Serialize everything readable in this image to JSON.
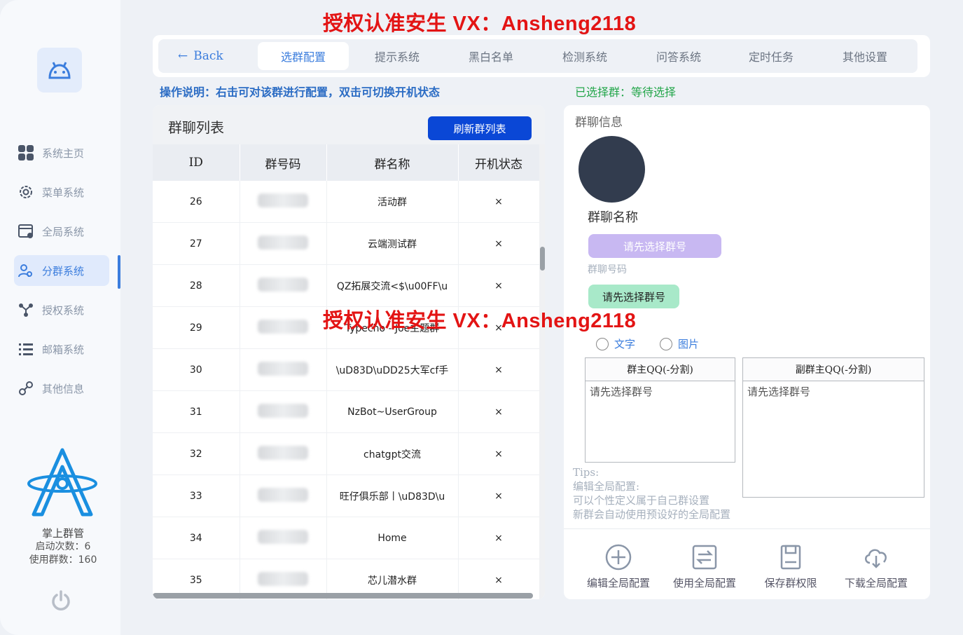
{
  "watermark": "授权认准安生 VX：Ansheng2118",
  "sidebar": {
    "items": [
      {
        "label": "系统主页",
        "icon": "grid-icon"
      },
      {
        "label": "菜单系统",
        "icon": "gear-icon"
      },
      {
        "label": "全局系统",
        "icon": "window-settings-icon"
      },
      {
        "label": "分群系统",
        "icon": "users-icon"
      },
      {
        "label": "授权系统",
        "icon": "network-icon"
      },
      {
        "label": "邮箱系统",
        "icon": "list-icon"
      },
      {
        "label": "其他信息",
        "icon": "link-icon"
      }
    ],
    "active_index": 3,
    "app_name": "掌上群管",
    "launch_count": "启动次数：6",
    "group_count": "使用群数：160"
  },
  "tabbar": {
    "back_label": "Back",
    "tabs": [
      "选群配置",
      "提示系统",
      "黑白名单",
      "检测系统",
      "问答系统",
      "定时任务",
      "其他设置"
    ],
    "active_index": 0
  },
  "hint": "操作说明：右击可对该群进行配置，双击可切换开机状态",
  "selected_group": "已选择群：等待选择",
  "group_list": {
    "title": "群聊列表",
    "refresh_label": "刷新群列表",
    "columns": [
      "ID",
      "群号码",
      "群名称",
      "开机状态"
    ],
    "rows": [
      {
        "id": "26",
        "name": "活动群",
        "status": "×"
      },
      {
        "id": "27",
        "name": "云端测试群",
        "status": "×"
      },
      {
        "id": "28",
        "name": "QZ拓展交流<$\\u00FF\\u",
        "status": "×"
      },
      {
        "id": "29",
        "name": "Typecho - Joe主题群",
        "status": "×"
      },
      {
        "id": "30",
        "name": "\\uD83D\\uDD25大军cf手",
        "status": "×"
      },
      {
        "id": "31",
        "name": "NzBot~UserGroup",
        "status": "×"
      },
      {
        "id": "32",
        "name": "chatgpt交流",
        "status": "×"
      },
      {
        "id": "33",
        "name": "旺仔俱乐部丨\\uD83D\\u",
        "status": "×"
      },
      {
        "id": "34",
        "name": "Home",
        "status": "×"
      },
      {
        "id": "35",
        "name": "芯儿潜水群",
        "status": "×"
      }
    ]
  },
  "group_info": {
    "title": "群聊信息",
    "group_name_label": "群聊名称",
    "select_first_button": "请先选择群号",
    "group_number_label": "群聊号码",
    "group_number_value": "请先选择群号",
    "radio_text": "文字",
    "radio_image": "图片",
    "owner_box_title": "群主QQ(-分割)",
    "owner_box_placeholder": "请先选择群号",
    "deputy_box_title": "副群主QQ(-分割)",
    "deputy_box_placeholder": "请先选择群号",
    "tips": [
      "Tips:",
      "编辑全局配置:",
      "可以个性定义属于自己群设置",
      "新群会自动使用预设好的全局配置"
    ],
    "actions": [
      {
        "label": "编辑全局配置",
        "icon": "plus-circle-icon"
      },
      {
        "label": "使用全局配置",
        "icon": "swap-icon"
      },
      {
        "label": "保存群权限",
        "icon": "save-icon"
      },
      {
        "label": "下载全局配置",
        "icon": "cloud-download-icon"
      }
    ]
  },
  "colors": {
    "accent": "#3b7ddd",
    "primary_button": "#0a47d6",
    "watermark": "#e31414",
    "success": "#24a64b"
  }
}
